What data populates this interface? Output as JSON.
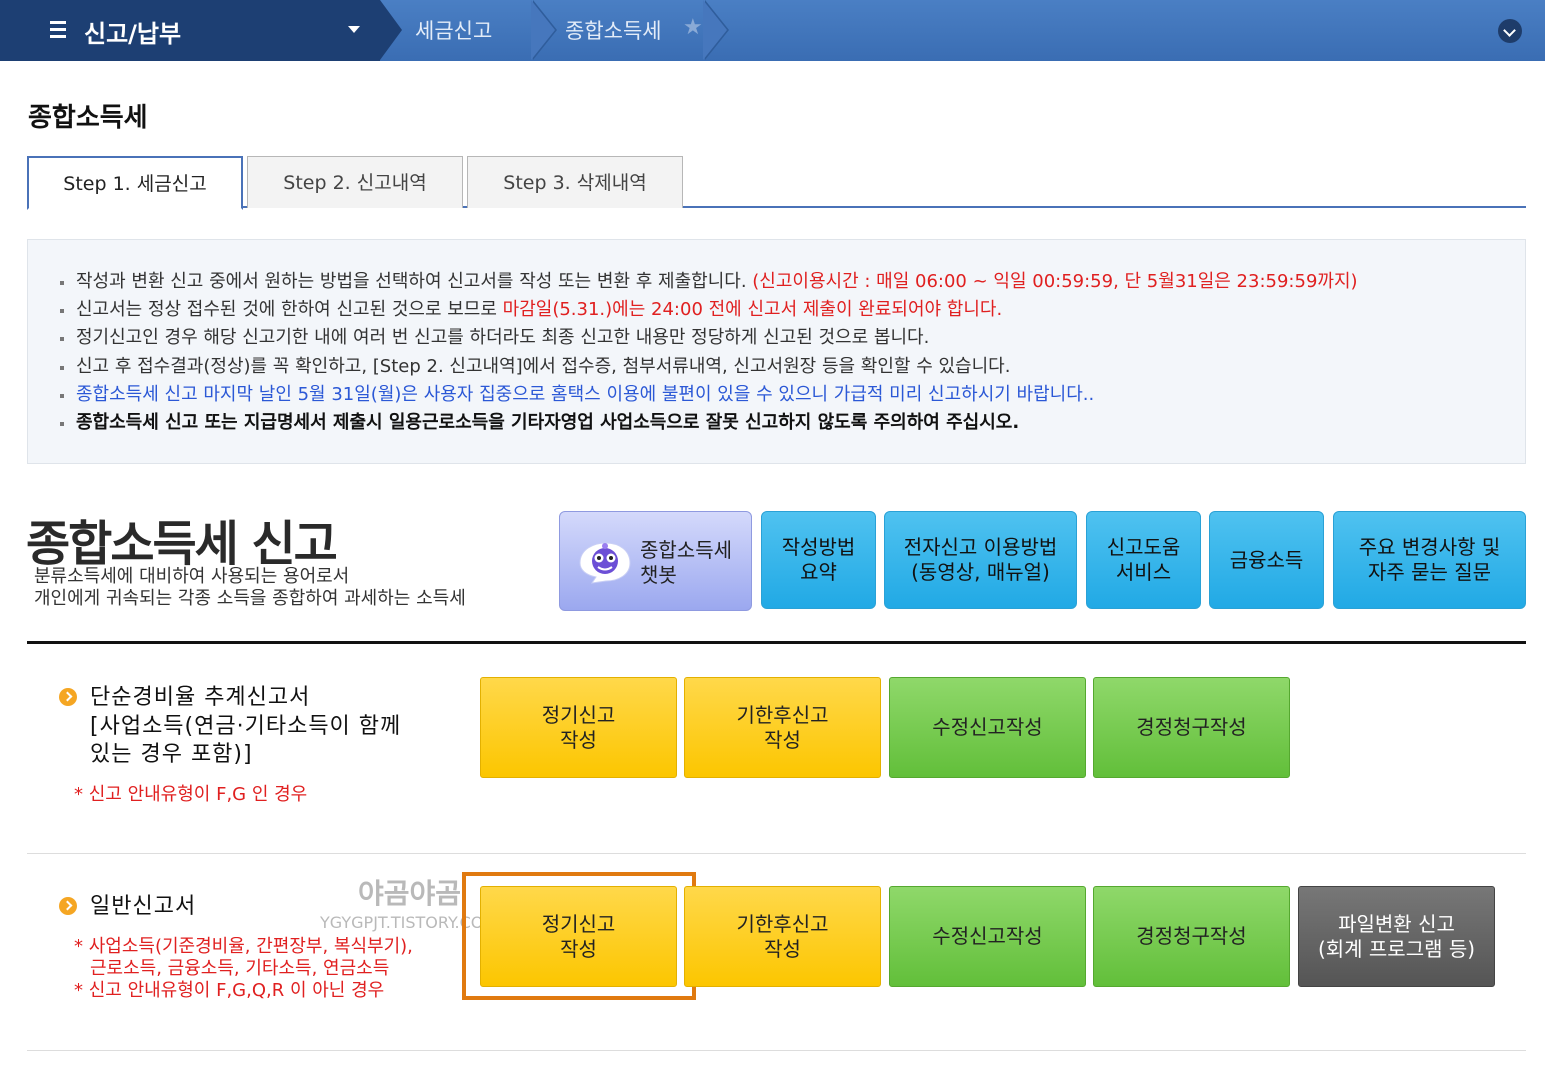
{
  "nav": {
    "title": "신고/납부",
    "crumbs": [
      "세금신고",
      "종합소득세"
    ]
  },
  "page_title": "종합소득세",
  "tabs": [
    "Step 1. 세금신고",
    "Step 2. 신고내역",
    "Step 3. 삭제내역"
  ],
  "notice": {
    "line1": "작성과 변환 신고 중에서 원하는 방법을 선택하여 신고서를 작성 또는 변환 후 제출합니다. ",
    "line1_red": "(신고이용시간 : 매일 06:00 ~ 익일 00:59:59, 단 5월31일은 23:59:59까지)",
    "line2": "신고서는 정상 접수된 것에 한하여 신고된 것으로 보므로 ",
    "line2_red": "마감일(5.31.)에는 24:00 전에 신고서 제출이 완료되어야 합니다.",
    "line3": "정기신고인 경우 해당 신고기한 내에 여러 번 신고를 하더라도 최종 신고한 내용만 정당하게 신고된 것으로 봅니다.",
    "line4": "신고 후 접수결과(정상)를 꼭 확인하고, [Step 2. 신고내역]에서 접수증, 첨부서류내역, 신고서원장 등을 확인할 수 있습니다.",
    "line5": "종합소득세 신고 마지막 날인 5월 31일(월)은 사용자 집중으로 홈택스 이용에 불편이 있을 수 있으니 가급적 미리 신고하시기 바랍니다..",
    "line6": "종합소득세 신고 또는 지급명세서 제출시 일용근로소득을 기타자영업 사업소득으로 잘못 신고하지 않도록 주의하여 주십시오."
  },
  "heading": {
    "title": "종합소득세 신고",
    "desc1": "분류소득세에 대비하여 사용되는 용어로서",
    "desc2": "개인에게 귀속되는 각종 소득을 종합하여 과세하는 소득세"
  },
  "top_buttons": {
    "chatbot1": "종합소득세",
    "chatbot2": "챗봇",
    "guide1": "작성방법",
    "guide2": "요약",
    "efile1": "전자신고 이용방법",
    "efile2": "(동영상, 매뉴얼)",
    "help1": "신고도움",
    "help2": "서비스",
    "finance": "금융소득",
    "faq1": "주요 변경사항 및",
    "faq2": "자주 묻는 질문"
  },
  "section1": {
    "title1": "단순경비율 추계신고서",
    "title2": "[사업소득(연금·기타소득이 함께",
    "title3": "있는 경우 포함)]",
    "note": "* 신고 안내유형이 F,G 인 경우",
    "btn_regular1": "정기신고",
    "btn_regular2": "작성",
    "btn_late1": "기한후신고",
    "btn_late2": "작성",
    "btn_amend": "수정신고작성",
    "btn_claim": "경정청구작성"
  },
  "section2": {
    "title": "일반신고서",
    "note1": "* 사업소득(기준경비율, 간편장부, 복식부기),",
    "note2": "근로소득, 금융소득, 기타소득, 연금소득",
    "note3": "* 신고 안내유형이 F,G,Q,R 이 아닌 경우",
    "btn_regular1": "정기신고",
    "btn_regular2": "작성",
    "btn_late1": "기한후신고",
    "btn_late2": "작성",
    "btn_amend": "수정신고작성",
    "btn_claim": "경정청구작성",
    "btn_file1": "파일변환 신고",
    "btn_file2": "(회계 프로그램 등)"
  },
  "watermark": {
    "main": "야곰야곰",
    "sub": "YGYGPJT.TISTORY.COM"
  },
  "colors": {
    "nav_dark": "#1d3f73",
    "nav_blue": "#3a6db3",
    "sky_button": "#21a9e5",
    "yellow_button": "#fcc600",
    "green_button": "#62bf3a",
    "gray_button": "#555555",
    "highlight": "#e07a10",
    "alert_red": "#e02020",
    "notice_blue": "#2b58d6"
  }
}
